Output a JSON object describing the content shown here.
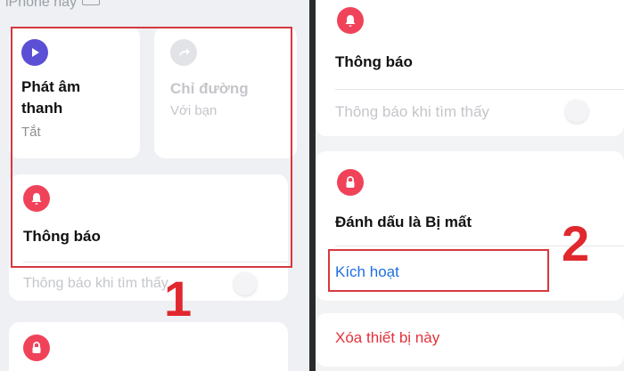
{
  "left": {
    "top_fragment": "iPhone này",
    "play_sound": {
      "title_line1": "Phát âm",
      "title_line2": "thanh",
      "status": "Tắt"
    },
    "directions": {
      "title": "Chỉ đường",
      "subtitle": "Với bạn"
    },
    "notifications": {
      "title": "Thông báo"
    },
    "notify_when_found": "Thông báo khi tìm thấy",
    "step_number": "1"
  },
  "right": {
    "notifications": {
      "title": "Thông báo"
    },
    "notify_when_found": "Thông báo khi tìm thấy",
    "mark_as_lost": {
      "title": "Đánh dấu là Bị mất",
      "activate": "Kích hoạt"
    },
    "erase_device": "Xóa thiết bị này",
    "step_number": "2"
  },
  "colors": {
    "play_icon": "#5b4fd6",
    "bell_icon": "#f0435a",
    "lock_icon": "#f0435a",
    "highlight": "#d6383f",
    "link_blue": "#1f6fe0",
    "link_red": "#e2323c"
  },
  "icons": [
    "play-icon",
    "share-arrow-icon",
    "bell-icon",
    "lock-icon"
  ]
}
